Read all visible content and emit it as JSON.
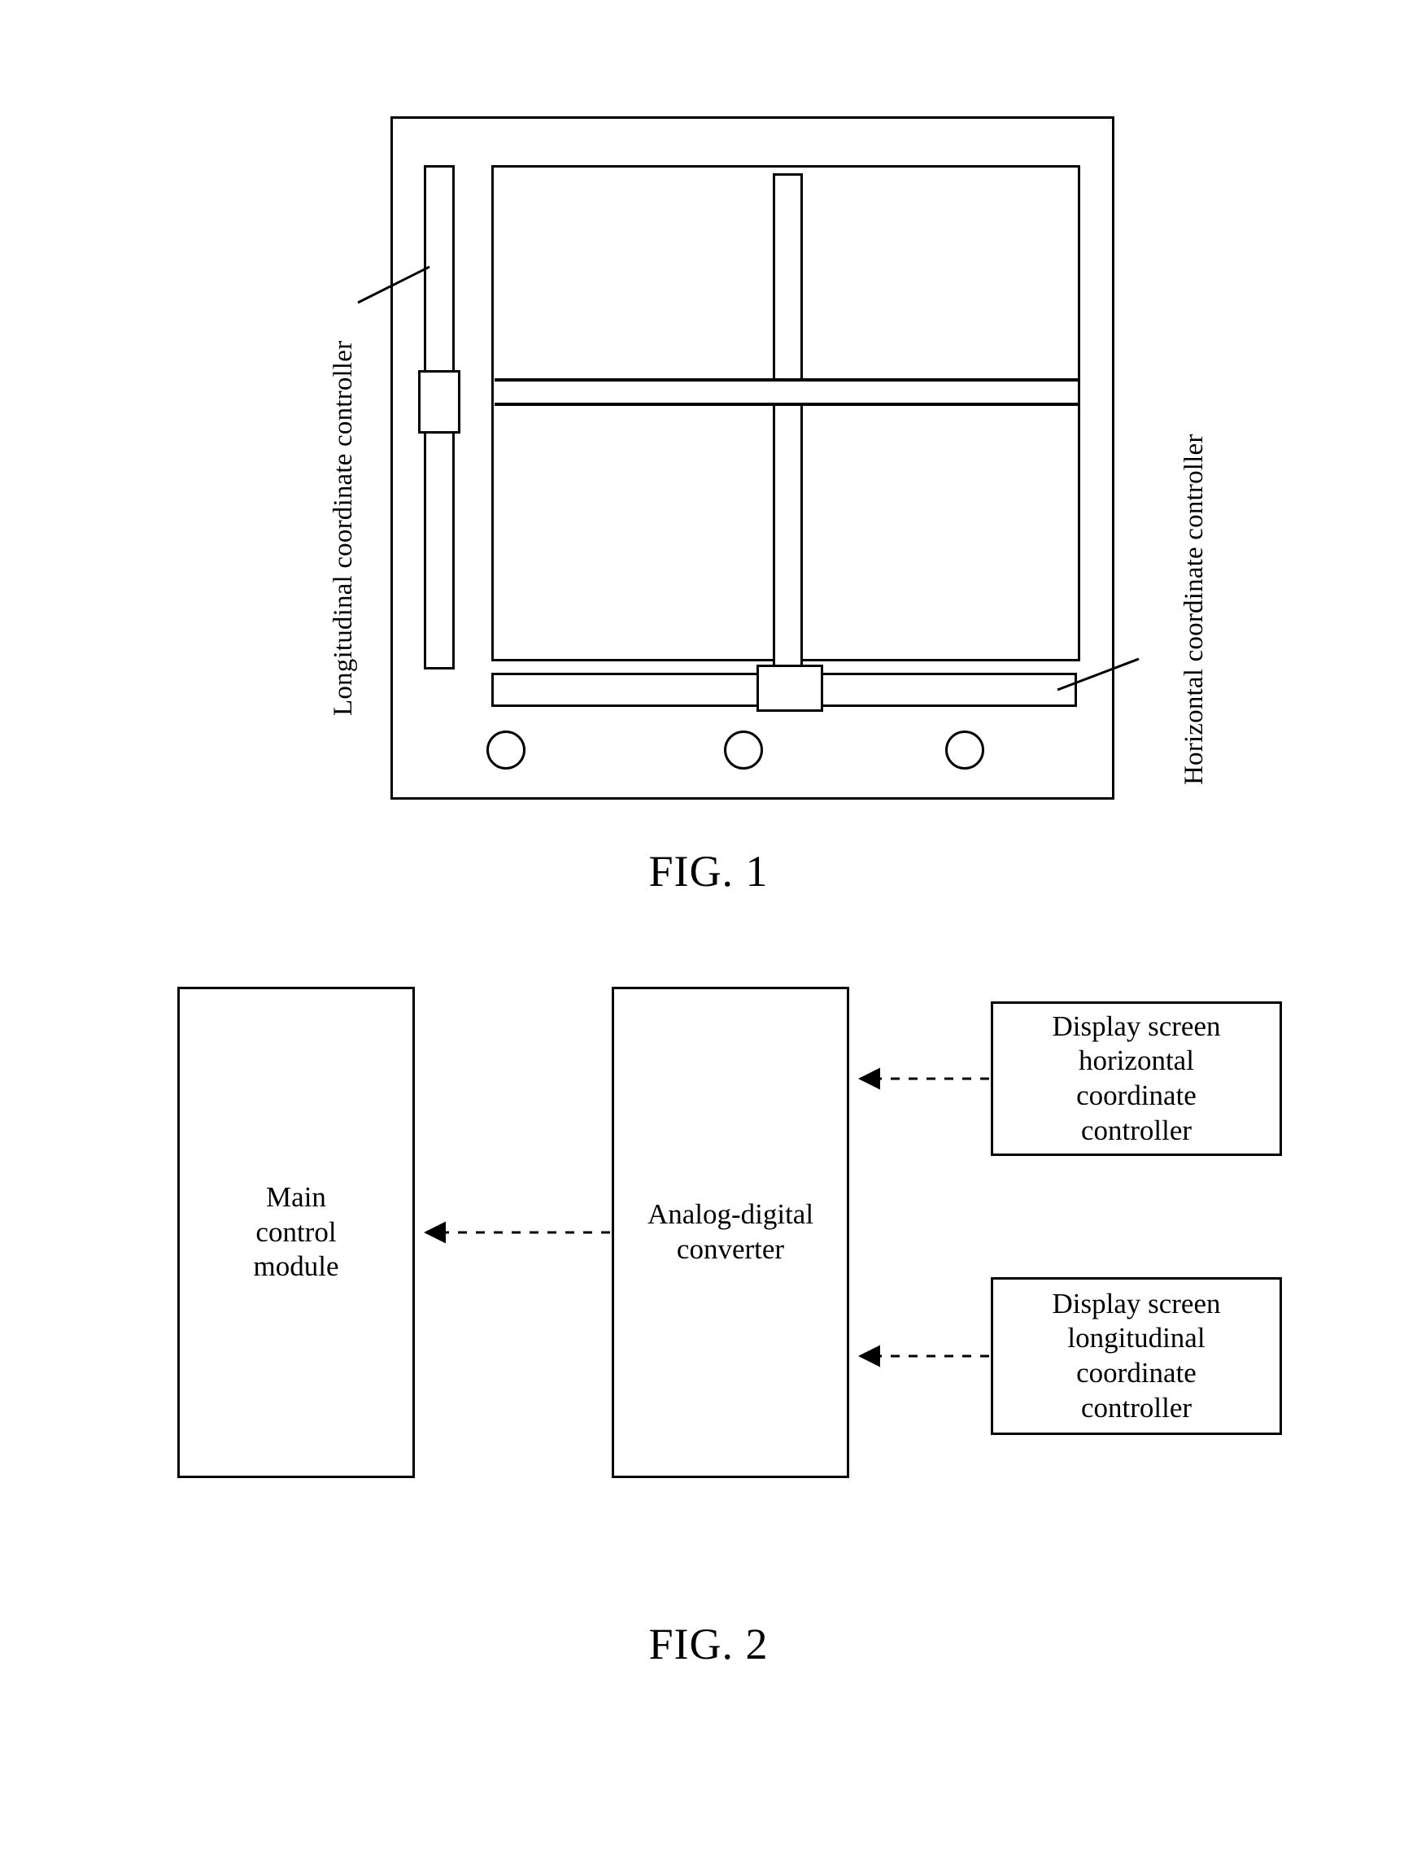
{
  "figure1": {
    "caption": "FIG. 1",
    "labels": {
      "longitudinal_controller": "Longitudinal coordinate controller",
      "horizontal_controller": "Horizontal coordinate controller"
    },
    "parts": {
      "device_frame": "device outer frame",
      "display_screen": "display screen",
      "vertical_track": "longitudinal coordinate controller track",
      "vertical_knob": "longitudinal slider knob",
      "screen_vertical_bar": "longitudinal scan bar",
      "screen_horizontal_bar": "horizontal scan bar",
      "horizontal_track": "horizontal coordinate controller track",
      "horizontal_knob": "horizontal slider knob",
      "buttons": [
        "button-1",
        "button-2",
        "button-3"
      ]
    }
  },
  "figure2": {
    "caption": "FIG. 2",
    "blocks": [
      {
        "id": "main-control-module",
        "text": "Main\ncontrol\nmodule"
      },
      {
        "id": "analog-digital-converter",
        "text": "Analog-digital\nconverter"
      },
      {
        "id": "display-screen-horizontal-coordinate-controller",
        "text": "Display screen\nhorizontal\ncoordinate\ncontroller"
      },
      {
        "id": "display-screen-longitudinal-coordinate-controller",
        "text": "Display screen\nlongitudinal\ncoordinate\ncontroller"
      }
    ],
    "connections": [
      {
        "from": "analog-digital-converter",
        "to": "main-control-module",
        "style": "dashed-arrow"
      },
      {
        "from": "display-screen-horizontal-coordinate-controller",
        "to": "analog-digital-converter",
        "style": "dashed-arrow"
      },
      {
        "from": "display-screen-longitudinal-coordinate-controller",
        "to": "analog-digital-converter",
        "style": "dashed-arrow"
      }
    ]
  },
  "colors": {
    "ink": "#000000",
    "paper": "#ffffff"
  }
}
